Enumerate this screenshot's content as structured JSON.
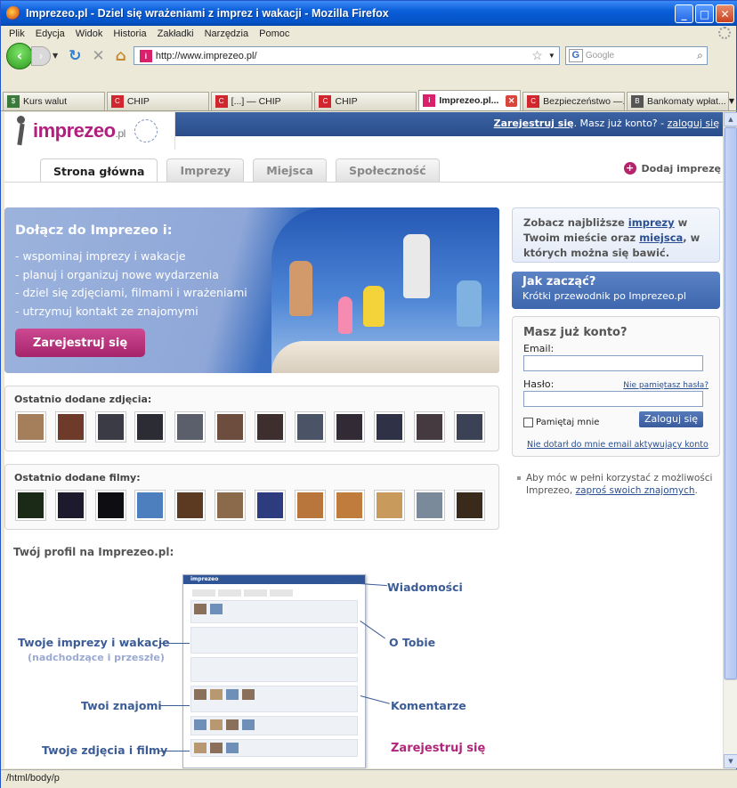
{
  "browser": {
    "title": "Imprezeo.pl - Dziel się wrażeniami z imprez i wakacji - Mozilla Firefox",
    "menu": [
      "Plik",
      "Edycja",
      "Widok",
      "Historia",
      "Zakładki",
      "Narzędzia",
      "Pomoc"
    ],
    "url": "http://www.imprezeo.pl/",
    "search_placeholder": "Google",
    "tabs": [
      {
        "label": "Kurs walut",
        "icon": "currency-icon"
      },
      {
        "label": "CHIP",
        "icon": "chip-icon"
      },
      {
        "label": "[...] — CHIP",
        "icon": "chip-icon"
      },
      {
        "label": "CHIP",
        "icon": "chip-icon"
      },
      {
        "label": "Imprezeo.pl...",
        "icon": "imprezeo-icon",
        "active": true
      },
      {
        "label": "Bezpieczeństwo —...",
        "icon": "chip-icon"
      },
      {
        "label": "Bankomaty wpłat...",
        "icon": "bank-icon"
      }
    ],
    "status": "/html/body/p"
  },
  "site": {
    "logo_main": "imprezeo",
    "logo_suffix": ".pl",
    "account": {
      "register": "Zarejestruj się",
      "question": ". Masz już konto? - ",
      "login": "zaloguj się"
    },
    "nav": [
      "Strona główna",
      "Imprezy",
      "Miejsca",
      "Społeczność"
    ],
    "add_event": "Dodaj imprezę",
    "hero": {
      "title": "Dołącz do Imprezeo i:",
      "bullets": [
        "- wspominaj imprezy i wakacje",
        "- planuj i organizuj nowe wydarzenia",
        "- dziel się zdjęciami, filmami i wrażeniami",
        "- utrzymuj kontakt ze znajomymi"
      ],
      "cta": "Zarejestruj się"
    },
    "photos": {
      "title": "Ostatnio dodane zdjęcia:",
      "count": 12
    },
    "videos": {
      "title": "Ostatnio dodane filmy:",
      "count": 12
    },
    "profile": {
      "title": "Twój profil na Imprezeo.pl:",
      "labels": {
        "events": "Twoje imprezy i wakacje",
        "events_sub": "(nadchodzące i przeszłe)",
        "friends": "Twoi znajomi",
        "media": "Twoje zdjęcia i filmy",
        "messages": "Wiadomości",
        "about": "O Tobie",
        "comments": "Komentarze",
        "register": "Zarejestruj się"
      }
    },
    "sidebar": {
      "nearby_pre": "Zobacz najbliższe ",
      "nearby_events": "imprezy",
      "nearby_mid": " w Twoim mieście oraz ",
      "nearby_places": "miejsca",
      "nearby_post": ", w których można się bawić.",
      "howto_title": "Jak zacząć?",
      "howto_sub": "Krótki przewodnik po Imprezeo.pl",
      "login_title": "Masz już konto?",
      "email_label": "Email:",
      "password_label": "Hasło:",
      "forgot": "Nie pamiętasz hasła?",
      "remember": "Pamiętaj mnie",
      "submit": "Zaloguj się",
      "no_email": "Nie dotarł do mnie email aktywujący konto",
      "invite_pre": "Aby móc w pełni korzystać z możliwości Imprezeo, ",
      "invite_link": "zaproś swoich znajomych",
      "invite_post": "."
    }
  },
  "colors": {
    "brand": "#b0207c",
    "header": "#2f5597",
    "link": "#2a4f92"
  }
}
